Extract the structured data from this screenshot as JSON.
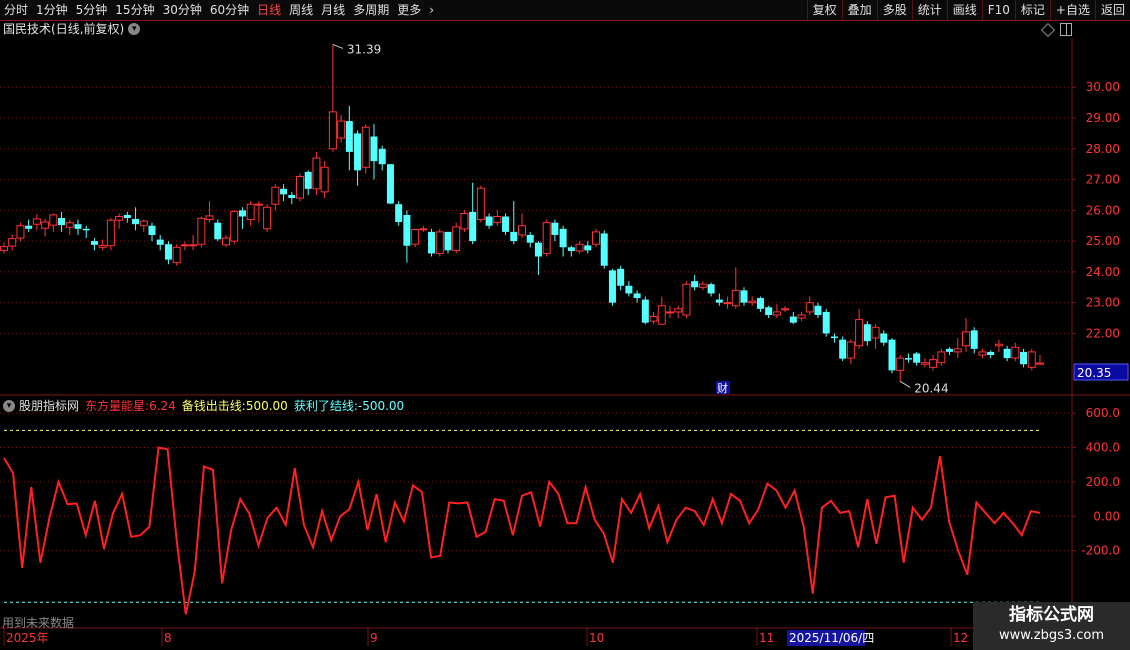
{
  "toolbar": {
    "periods": [
      "分时",
      "1分钟",
      "5分钟",
      "15分钟",
      "30分钟",
      "60分钟",
      "日线",
      "周线",
      "月线",
      "多周期",
      "更多"
    ],
    "active_period": "日线",
    "tools": [
      "复权",
      "叠加",
      "多股",
      "统计",
      "画线",
      "F10",
      "标记",
      "+自选",
      "返回"
    ]
  },
  "stock": {
    "name": "国民技术",
    "mode": "(日线,前复权)"
  },
  "price_chart": {
    "y_ticks": [
      "30.00",
      "29.00",
      "28.00",
      "27.00",
      "26.00",
      "25.00",
      "24.00",
      "23.00",
      "22.00"
    ],
    "current_price": "20.35",
    "high_label": "31.39",
    "low_label": "20.44",
    "event_marker": "财"
  },
  "indicator": {
    "name": "股朋指标网",
    "l1_label": "东方量能星:",
    "l1_value": "6.24",
    "l2_label": "备钱出击线:",
    "l2_value": "500.00",
    "l3_label": "获利了结线:",
    "l3_value": "-500.00",
    "y_ticks": [
      "600.0",
      "400.0",
      "200.0",
      "0.00",
      "-200.0"
    ]
  },
  "future_note": "用到未来数据",
  "xaxis": {
    "labels": [
      "2025年",
      "8",
      "9",
      "10",
      "11",
      "12"
    ],
    "cursor_date": "2025/11/06/四"
  },
  "watermark": {
    "title": "指标公式网",
    "url": "www.zbgs3.com"
  },
  "colors": {
    "up": "#ff3333",
    "down": "#54ffff",
    "grid": "#7a1515",
    "indicator": "#ff2020"
  },
  "chart_data": [
    {
      "type": "candlestick",
      "ylim": [
        20.0,
        31.6
      ],
      "candles": [
        [
          24.7,
          24.82,
          24.6,
          24.95
        ],
        [
          24.84,
          25.08,
          24.7,
          25.2
        ],
        [
          25.1,
          25.5,
          25.0,
          25.6
        ],
        [
          25.5,
          25.4,
          25.3,
          25.7
        ],
        [
          25.55,
          25.72,
          25.35,
          25.88
        ],
        [
          25.42,
          25.62,
          25.15,
          25.72
        ],
        [
          25.52,
          25.85,
          25.3,
          25.9
        ],
        [
          25.75,
          25.52,
          25.3,
          25.95
        ],
        [
          25.45,
          25.6,
          25.2,
          25.7
        ],
        [
          25.55,
          25.4,
          25.2,
          25.7
        ],
        [
          25.4,
          25.35,
          25.1,
          25.5
        ],
        [
          25.0,
          24.88,
          24.7,
          25.1
        ],
        [
          24.8,
          24.86,
          24.7,
          25.05
        ],
        [
          24.85,
          25.68,
          24.7,
          25.75
        ],
        [
          25.68,
          25.8,
          25.4,
          25.9
        ],
        [
          25.85,
          25.75,
          25.6,
          25.95
        ],
        [
          25.72,
          25.55,
          25.35,
          26.1
        ],
        [
          25.5,
          25.65,
          25.3,
          25.7
        ],
        [
          25.5,
          25.2,
          25.0,
          25.6
        ],
        [
          25.05,
          24.88,
          24.7,
          25.2
        ],
        [
          24.9,
          24.4,
          24.25,
          25.0
        ],
        [
          24.3,
          24.8,
          24.2,
          24.9
        ],
        [
          24.88,
          24.88,
          24.7,
          24.98
        ],
        [
          24.88,
          24.88,
          24.7,
          25.2
        ],
        [
          24.9,
          25.74,
          24.8,
          25.8
        ],
        [
          25.7,
          25.82,
          25.6,
          26.3
        ],
        [
          25.6,
          25.06,
          25.0,
          25.7
        ],
        [
          24.88,
          25.1,
          24.8,
          25.2
        ],
        [
          25.0,
          25.96,
          24.9,
          26.0
        ],
        [
          26.0,
          25.8,
          25.4,
          26.1
        ],
        [
          25.7,
          26.2,
          25.5,
          26.3
        ],
        [
          26.2,
          26.2,
          25.6,
          26.3
        ],
        [
          25.4,
          26.1,
          25.3,
          26.2
        ],
        [
          26.2,
          26.75,
          26.0,
          26.85
        ],
        [
          26.7,
          26.52,
          26.3,
          26.85
        ],
        [
          26.5,
          26.4,
          26.2,
          26.6
        ],
        [
          26.4,
          27.1,
          26.3,
          27.2
        ],
        [
          27.25,
          26.7,
          26.5,
          27.3
        ],
        [
          26.7,
          27.7,
          26.5,
          27.9
        ],
        [
          26.6,
          27.4,
          26.4,
          27.6
        ],
        [
          28.0,
          29.2,
          27.9,
          31.39
        ],
        [
          28.35,
          28.9,
          28.2,
          29.1
        ],
        [
          28.9,
          27.9,
          27.3,
          29.4
        ],
        [
          28.5,
          27.3,
          26.8,
          28.6
        ],
        [
          27.4,
          28.7,
          27.2,
          28.8
        ],
        [
          28.4,
          27.6,
          27.0,
          28.8
        ],
        [
          28.0,
          27.5,
          27.3,
          28.1
        ],
        [
          27.5,
          26.22,
          26.2,
          27.5
        ],
        [
          26.2,
          25.62,
          25.5,
          26.3
        ],
        [
          25.85,
          24.85,
          24.3,
          26.0
        ],
        [
          24.9,
          25.38,
          24.8,
          25.4
        ],
        [
          25.4,
          25.4,
          25.3,
          25.5
        ],
        [
          25.3,
          24.6,
          24.5,
          25.4
        ],
        [
          24.6,
          25.3,
          24.5,
          25.4
        ],
        [
          25.3,
          24.7,
          24.6,
          25.3
        ],
        [
          24.7,
          25.46,
          24.6,
          25.6
        ],
        [
          25.4,
          25.9,
          25.3,
          26.0
        ],
        [
          25.95,
          25.0,
          24.9,
          26.9
        ],
        [
          25.7,
          26.72,
          25.6,
          26.8
        ],
        [
          25.8,
          25.5,
          25.4,
          25.9
        ],
        [
          25.6,
          25.8,
          25.5,
          26.0
        ],
        [
          25.8,
          25.3,
          25.2,
          25.9
        ],
        [
          25.3,
          25.0,
          24.9,
          26.3
        ],
        [
          25.2,
          25.5,
          25.1,
          25.9
        ],
        [
          25.2,
          24.95,
          24.8,
          25.3
        ],
        [
          24.95,
          24.5,
          23.9,
          25.0
        ],
        [
          24.6,
          25.6,
          24.5,
          25.7
        ],
        [
          25.6,
          25.2,
          25.0,
          25.7
        ],
        [
          25.4,
          24.8,
          24.5,
          25.5
        ],
        [
          24.8,
          24.68,
          24.5,
          24.85
        ],
        [
          24.68,
          24.9,
          24.6,
          25.0
        ],
        [
          24.86,
          24.7,
          24.6,
          25.0
        ],
        [
          24.9,
          25.3,
          24.8,
          25.4
        ],
        [
          25.25,
          24.2,
          24.1,
          25.35
        ],
        [
          24.05,
          23.0,
          22.9,
          24.1
        ],
        [
          24.1,
          23.55,
          23.4,
          24.2
        ],
        [
          23.55,
          23.3,
          23.2,
          23.7
        ],
        [
          23.3,
          23.15,
          23.0,
          23.4
        ],
        [
          23.1,
          22.35,
          22.3,
          23.2
        ],
        [
          22.4,
          22.55,
          22.3,
          22.7
        ],
        [
          22.3,
          22.9,
          22.3,
          23.2
        ],
        [
          22.7,
          22.7,
          22.5,
          22.9
        ],
        [
          22.7,
          22.8,
          22.5,
          22.9
        ],
        [
          22.6,
          23.6,
          22.5,
          23.7
        ],
        [
          23.7,
          23.5,
          23.4,
          23.9
        ],
        [
          23.5,
          23.6,
          23.4,
          23.7
        ],
        [
          23.6,
          23.3,
          23.2,
          23.65
        ],
        [
          23.1,
          23.0,
          22.9,
          23.3
        ],
        [
          23.0,
          23.0,
          22.8,
          23.2
        ],
        [
          22.9,
          23.4,
          22.8,
          24.15
        ],
        [
          23.4,
          23.0,
          22.9,
          23.5
        ],
        [
          23.0,
          23.05,
          22.9,
          23.2
        ],
        [
          23.15,
          22.8,
          22.7,
          23.2
        ],
        [
          22.85,
          22.6,
          22.5,
          22.9
        ],
        [
          22.6,
          22.7,
          22.5,
          22.95
        ],
        [
          22.8,
          22.8,
          22.7,
          22.9
        ],
        [
          22.55,
          22.35,
          22.3,
          22.7
        ],
        [
          22.5,
          22.6,
          22.4,
          22.7
        ],
        [
          22.7,
          23.0,
          22.6,
          23.2
        ],
        [
          22.9,
          22.6,
          22.5,
          23.0
        ],
        [
          22.7,
          22.0,
          21.9,
          22.8
        ],
        [
          21.9,
          21.85,
          21.7,
          22.0
        ],
        [
          21.8,
          21.18,
          21.1,
          21.9
        ],
        [
          21.2,
          21.72,
          21.0,
          21.8
        ],
        [
          21.6,
          22.45,
          21.5,
          22.8
        ],
        [
          22.3,
          21.75,
          21.6,
          22.4
        ],
        [
          21.85,
          22.2,
          21.5,
          22.3
        ],
        [
          22.0,
          21.7,
          21.6,
          22.1
        ],
        [
          21.8,
          20.8,
          20.7,
          21.85
        ],
        [
          20.8,
          21.2,
          20.44,
          21.3
        ],
        [
          21.2,
          21.15,
          21.05,
          21.35
        ],
        [
          21.35,
          21.05,
          20.95,
          21.4
        ],
        [
          21.0,
          21.05,
          20.9,
          21.2
        ],
        [
          20.9,
          21.15,
          20.8,
          21.3
        ],
        [
          21.05,
          21.4,
          20.95,
          21.5
        ],
        [
          21.5,
          21.4,
          21.3,
          21.55
        ],
        [
          21.4,
          21.5,
          21.2,
          21.85
        ],
        [
          21.6,
          22.05,
          21.4,
          22.5
        ],
        [
          22.1,
          21.5,
          21.35,
          22.2
        ],
        [
          21.3,
          21.4,
          21.2,
          21.5
        ],
        [
          21.4,
          21.3,
          21.2,
          21.45
        ],
        [
          21.6,
          21.65,
          21.4,
          21.8
        ],
        [
          21.5,
          21.2,
          21.1,
          21.6
        ],
        [
          21.2,
          21.55,
          21.1,
          21.7
        ],
        [
          21.4,
          21.0,
          20.9,
          21.5
        ],
        [
          20.9,
          21.4,
          20.8,
          21.5
        ],
        [
          21.0,
          21.04,
          20.98,
          21.3
        ]
      ]
    },
    {
      "type": "line",
      "series": [
        {
          "name": "东方量能星",
          "values": [
            340,
            250,
            -300,
            170,
            -270,
            -10,
            200,
            70,
            75,
            -110,
            90,
            -190,
            20,
            130,
            -120,
            -110,
            -60,
            400,
            390,
            -140,
            -570,
            -320,
            290,
            270,
            -390,
            -80,
            100,
            15,
            -170,
            -10,
            50,
            -50,
            280,
            -50,
            -180,
            30,
            -140,
            0,
            40,
            200,
            -80,
            130,
            -150,
            80,
            -30,
            180,
            140,
            -240,
            -230,
            80,
            75,
            80,
            -120,
            -90,
            100,
            90,
            -110,
            120,
            140,
            -60,
            200,
            130,
            -40,
            -40,
            170,
            -20,
            -100,
            -270,
            100,
            20,
            130,
            -70,
            60,
            -150,
            -20,
            50,
            30,
            -50,
            100,
            -40,
            130,
            90,
            -40,
            40,
            190,
            150,
            50,
            150,
            -60,
            -450,
            50,
            90,
            20,
            30,
            -180,
            100,
            -160,
            110,
            120,
            -270,
            50,
            -20,
            50,
            350,
            -30,
            -200,
            -340,
            80,
            20,
            -40,
            20,
            -40,
            -110,
            30,
            20
          ]
        }
      ],
      "reference_lines": [
        500,
        -500
      ],
      "ylim": [
        -650,
        700
      ]
    }
  ]
}
